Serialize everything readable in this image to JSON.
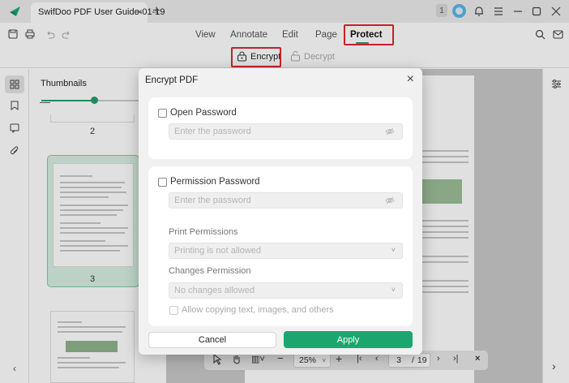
{
  "titlebar": {
    "tab_title": "SwifDoo PDF User Guide-01-19",
    "tab_close": "×",
    "new_tab": "+",
    "badge": "1"
  },
  "menu": {
    "items": [
      "View",
      "Annotate",
      "Edit",
      "Page",
      "Protect"
    ],
    "active": "Protect"
  },
  "subtoolbar": {
    "encrypt": "Encrypt",
    "decrypt": "Decrypt"
  },
  "thumbnails": {
    "title": "Thumbnails",
    "zoom_level": 0.5,
    "pages": [
      "2",
      "3"
    ]
  },
  "bottombar": {
    "minus": "−",
    "zoom": "25%",
    "plus": "+",
    "current_page": "3",
    "page_sep": "/",
    "total_pages": "19"
  },
  "dialog": {
    "title": "Encrypt PDF",
    "open_password_label": "Open Password",
    "open_password_placeholder": "Enter the password",
    "permission_password_label": "Permission Password",
    "permission_password_placeholder": "Enter the password",
    "print_permissions_label": "Print Permissions",
    "print_permissions_value": "Printing is not allowed",
    "changes_permission_label": "Changes Permission",
    "changes_permission_value": "No changes allowed",
    "copy_label": "Allow copying text, images, and others",
    "cancel": "Cancel",
    "apply": "Apply"
  },
  "colors": {
    "accent": "#1ca66f",
    "highlight": "#e0282e"
  }
}
